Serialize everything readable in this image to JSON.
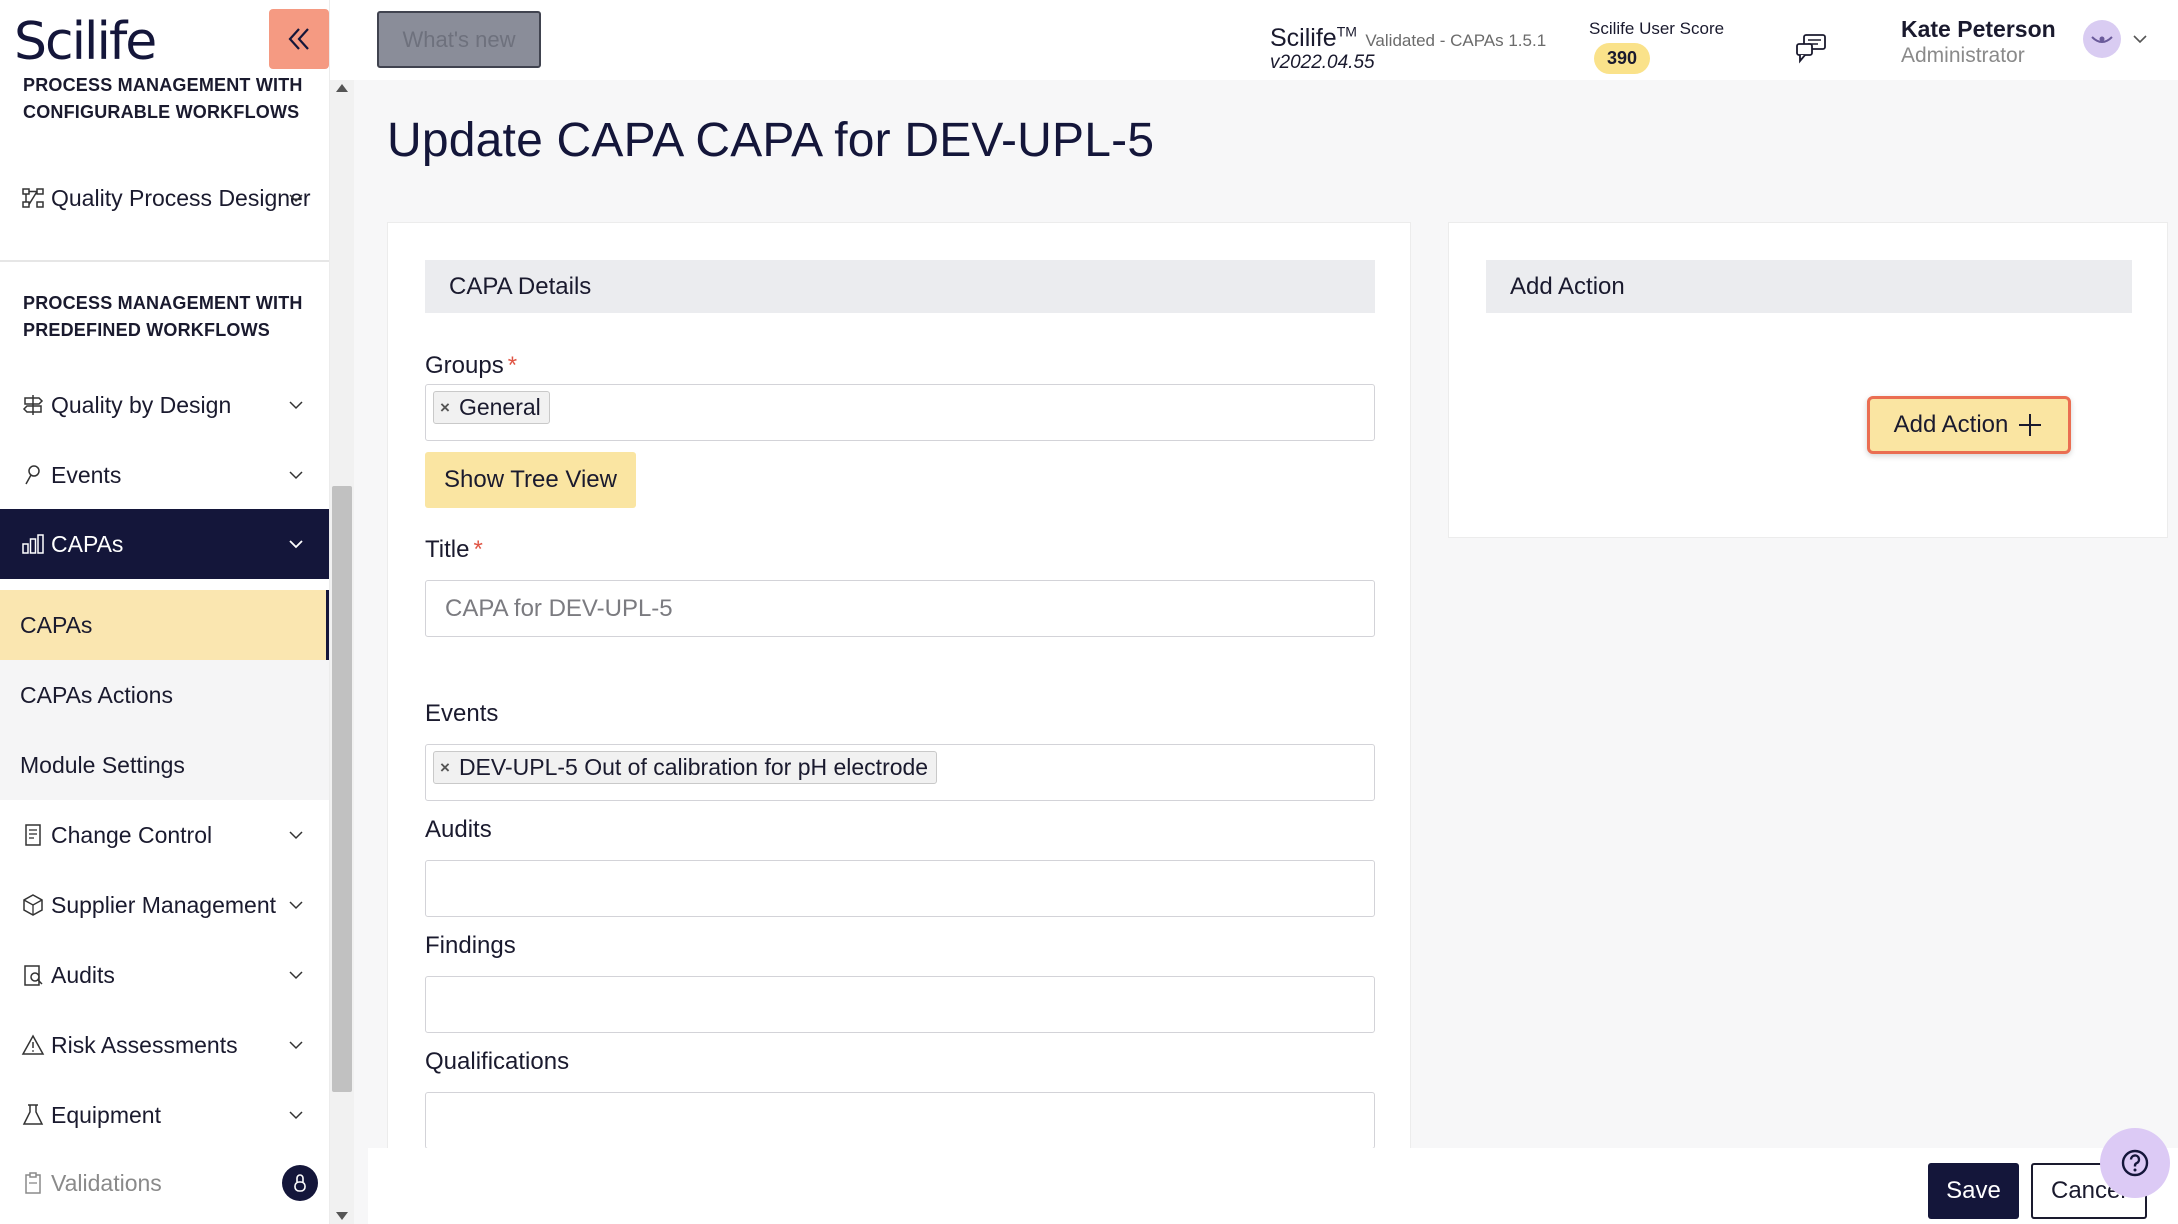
{
  "brand": {
    "logo_text": "Scilife"
  },
  "sidebar": {
    "section_configurable": "PROCESS MANAGEMENT WITH CONFIGURABLE WORKFLOWS",
    "section_predefined": "PROCESS MANAGEMENT WITH PREDEFINED WORKFLOWS",
    "items": [
      {
        "label": "Quality Process Designer",
        "icon": "workflow-icon"
      },
      {
        "label": "Quality by Design",
        "icon": "signpost-icon"
      },
      {
        "label": "Events",
        "icon": "pin-icon"
      },
      {
        "label": "CAPAs",
        "icon": "chart-icon"
      },
      {
        "label": "Change Control",
        "icon": "scroll-icon"
      },
      {
        "label": "Supplier Management",
        "icon": "box-icon"
      },
      {
        "label": "Audits",
        "icon": "clipboard-search-icon"
      },
      {
        "label": "Risk Assessments",
        "icon": "warning-icon"
      },
      {
        "label": "Equipment",
        "icon": "flask-icon"
      },
      {
        "label": "Validations",
        "icon": "clipboard-check-icon"
      }
    ],
    "capa_subitems": [
      {
        "label": "CAPAs"
      },
      {
        "label": "CAPAs Actions"
      },
      {
        "label": "Module Settings"
      }
    ]
  },
  "header": {
    "whats_new": "What's new",
    "app_name": "Scilife",
    "app_tm": "TM",
    "app_status": "Validated - CAPAs 1.5.1",
    "app_version": "v2022.04.55",
    "score_label": "Scilife User Score",
    "score_value": "390",
    "user_name": "Kate Peterson",
    "user_role": "Administrator"
  },
  "page": {
    "title": "Update CAPA CAPA for DEV-UPL-5"
  },
  "capa_details": {
    "heading": "CAPA Details",
    "groups_label": "Groups",
    "groups_required": "*",
    "groups_tags": [
      "General"
    ],
    "show_tree_view": "Show Tree View",
    "title_label": "Title",
    "title_required": "*",
    "title_value": "CAPA for DEV-UPL-5",
    "events_label": "Events",
    "events_tags": [
      "DEV-UPL-5 Out of calibration for pH electrode"
    ],
    "audits_label": "Audits",
    "findings_label": "Findings",
    "qualifications_label": "Qualifications"
  },
  "add_action_panel": {
    "heading": "Add Action",
    "button_label": "Add Action"
  },
  "footer": {
    "save": "Save",
    "cancel": "Cancel"
  },
  "colors": {
    "navy": "#14163a",
    "accent_yellow": "#fae5a2",
    "highlight_orange": "#ea6e52",
    "collapse_salmon": "#f59a82",
    "required_red": "#e05545"
  }
}
